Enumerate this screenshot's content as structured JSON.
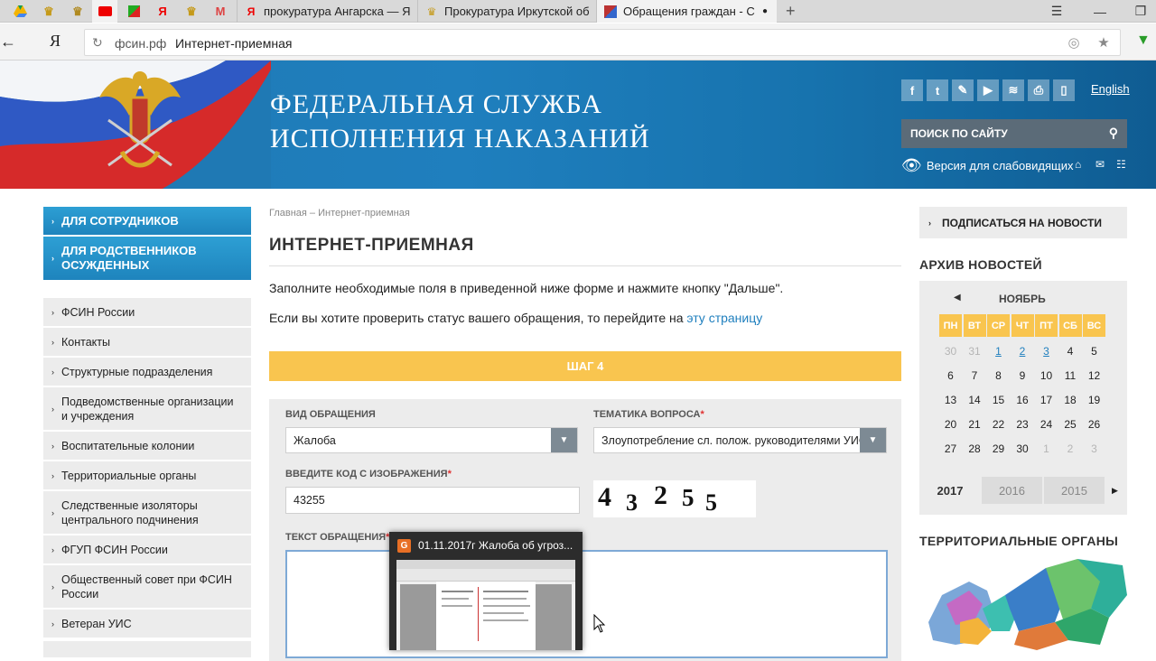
{
  "browser": {
    "tabs": [
      {
        "title": "прокуратура Ангарска — Я"
      },
      {
        "title": "Прокуратура Иркутской об"
      },
      {
        "title": "Обращения граждан - С"
      }
    ],
    "address": {
      "domain": "фсин.рф",
      "page_title": "Интернет-приемная"
    }
  },
  "header": {
    "title_line1": "ФЕДЕРАЛЬНАЯ СЛУЖБА",
    "title_line2": "ИСПОЛНЕНИЯ НАКАЗАНИЙ",
    "english": "English",
    "search_placeholder": "ПОИСК ПО САЙТУ",
    "low_vision": "Версия для слабовидящих"
  },
  "left_nav": {
    "blue_items": [
      "ДЛЯ СОТРУДНИКОВ",
      "ДЛЯ РОДСТВЕННИКОВ ОСУЖДЕННЫХ"
    ],
    "items": [
      "ФСИН России",
      "Контакты",
      "Структурные подразделения",
      "Подведомственные организации и учреждения",
      "Воспитательные колонии",
      "Территориальные органы",
      "Следственные изоляторы центрального подчинения",
      "ФГУП ФСИН России",
      "Общественный совет при ФСИН России",
      "Ветеран УИС"
    ]
  },
  "main": {
    "breadcrumb": "Главная – Интернет-приемная",
    "title": "ИНТЕРНЕТ-ПРИЕМНАЯ",
    "intro": "Заполните необходимые поля в приведенной ниже форме и нажмите кнопку \"Дальше\".",
    "status_prefix": "Если вы хотите проверить статус вашего обращения, то перейдите на ",
    "status_link": "эту страницу",
    "step": "ШАГ 4",
    "form": {
      "type_label": "ВИД ОБРАЩЕНИЯ",
      "type_value": "Жалоба",
      "topic_label": "ТЕМАТИКА ВОПРОСА",
      "topic_value": "Злоупотребление сл. полож. руководителями УИС",
      "code_label": "ВВЕДИТЕ КОД С ИЗОБРАЖЕНИЯ",
      "code_value": "43255",
      "captcha_digits": [
        "4",
        "3",
        "2",
        "5",
        "5"
      ],
      "text_label": "ТЕКСТ ОБРАЩЕНИЯ",
      "required_mark": "*"
    }
  },
  "right": {
    "subscribe": "ПОДПИСАТЬСЯ НА НОВОСТИ",
    "archive_title": "АРХИВ НОВОСТЕЙ",
    "calendar": {
      "month": "НОЯБРЬ",
      "weekdays": [
        "ПН",
        "ВТ",
        "СР",
        "ЧТ",
        "ПТ",
        "СБ",
        "ВС"
      ],
      "weeks": [
        [
          {
            "d": "30",
            "s": "muted"
          },
          {
            "d": "31",
            "s": "muted"
          },
          {
            "d": "1",
            "s": "link"
          },
          {
            "d": "2",
            "s": "link"
          },
          {
            "d": "3",
            "s": "link"
          },
          {
            "d": "4",
            "s": ""
          },
          {
            "d": "5",
            "s": ""
          }
        ],
        [
          {
            "d": "6",
            "s": ""
          },
          {
            "d": "7",
            "s": ""
          },
          {
            "d": "8",
            "s": ""
          },
          {
            "d": "9",
            "s": ""
          },
          {
            "d": "10",
            "s": ""
          },
          {
            "d": "11",
            "s": ""
          },
          {
            "d": "12",
            "s": ""
          }
        ],
        [
          {
            "d": "13",
            "s": ""
          },
          {
            "d": "14",
            "s": ""
          },
          {
            "d": "15",
            "s": ""
          },
          {
            "d": "16",
            "s": ""
          },
          {
            "d": "17",
            "s": ""
          },
          {
            "d": "18",
            "s": ""
          },
          {
            "d": "19",
            "s": ""
          }
        ],
        [
          {
            "d": "20",
            "s": ""
          },
          {
            "d": "21",
            "s": ""
          },
          {
            "d": "22",
            "s": ""
          },
          {
            "d": "23",
            "s": ""
          },
          {
            "d": "24",
            "s": ""
          },
          {
            "d": "25",
            "s": ""
          },
          {
            "d": "26",
            "s": ""
          }
        ],
        [
          {
            "d": "27",
            "s": ""
          },
          {
            "d": "28",
            "s": ""
          },
          {
            "d": "29",
            "s": ""
          },
          {
            "d": "30",
            "s": ""
          },
          {
            "d": "1",
            "s": "muted"
          },
          {
            "d": "2",
            "s": "muted"
          },
          {
            "d": "3",
            "s": "muted"
          }
        ]
      ],
      "years": [
        "2017",
        "2016",
        "2015"
      ]
    },
    "territorial_title": "ТЕРРИТОРИАЛЬНЫЕ ОРГАНЫ"
  },
  "popup": {
    "title": "01.11.2017г Жалоба об угроз..."
  },
  "colors": {
    "accent_blue": "#1f7fbe",
    "step_yellow": "#f9c54f",
    "panel_grey": "#ececec"
  }
}
